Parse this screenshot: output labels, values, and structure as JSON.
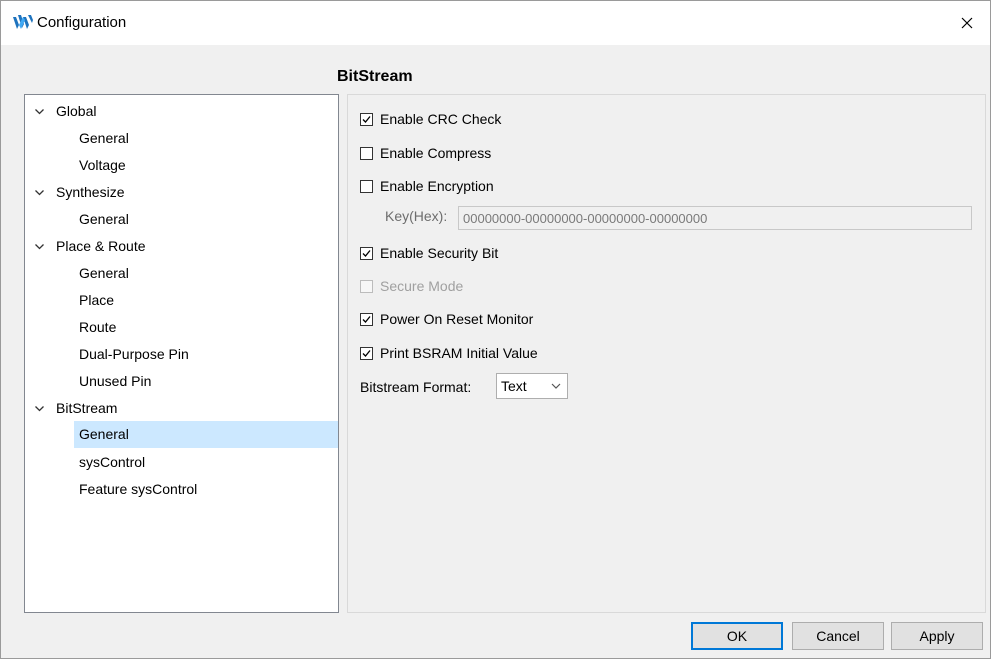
{
  "window": {
    "title": "Configuration"
  },
  "section_title": "BitStream",
  "tree": {
    "items": [
      {
        "label": "Global"
      },
      {
        "label": "General"
      },
      {
        "label": "Voltage"
      },
      {
        "label": "Synthesize"
      },
      {
        "label": "General"
      },
      {
        "label": "Place & Route"
      },
      {
        "label": "General"
      },
      {
        "label": "Place"
      },
      {
        "label": "Route"
      },
      {
        "label": "Dual-Purpose Pin"
      },
      {
        "label": "Unused Pin"
      },
      {
        "label": "BitStream"
      },
      {
        "label": "General"
      },
      {
        "label": "sysControl"
      },
      {
        "label": "Feature sysControl"
      }
    ],
    "selected": "BitStream > General"
  },
  "options": {
    "crc": {
      "label": "Enable CRC Check",
      "checked": true
    },
    "compress": {
      "label": "Enable Compress",
      "checked": false
    },
    "encryption": {
      "label": "Enable Encryption",
      "checked": false
    },
    "key": {
      "label": "Key(Hex):",
      "value": "00000000-00000000-00000000-00000000"
    },
    "security": {
      "label": "Enable Security Bit",
      "checked": true
    },
    "secure_mode": {
      "label": "Secure Mode",
      "checked": false,
      "enabled": false
    },
    "power_on_reset": {
      "label": "Power On Reset Monitor",
      "checked": true
    },
    "bsram": {
      "label": "Print BSRAM Initial Value",
      "checked": true
    },
    "format": {
      "label": "Bitstream Format:",
      "value": "Text"
    }
  },
  "buttons": {
    "ok": "OK",
    "cancel": "Cancel",
    "apply": "Apply"
  },
  "colors": {
    "selection": "#cce8ff",
    "default_button_border": "#0078d7",
    "logo": "#1e73be"
  }
}
